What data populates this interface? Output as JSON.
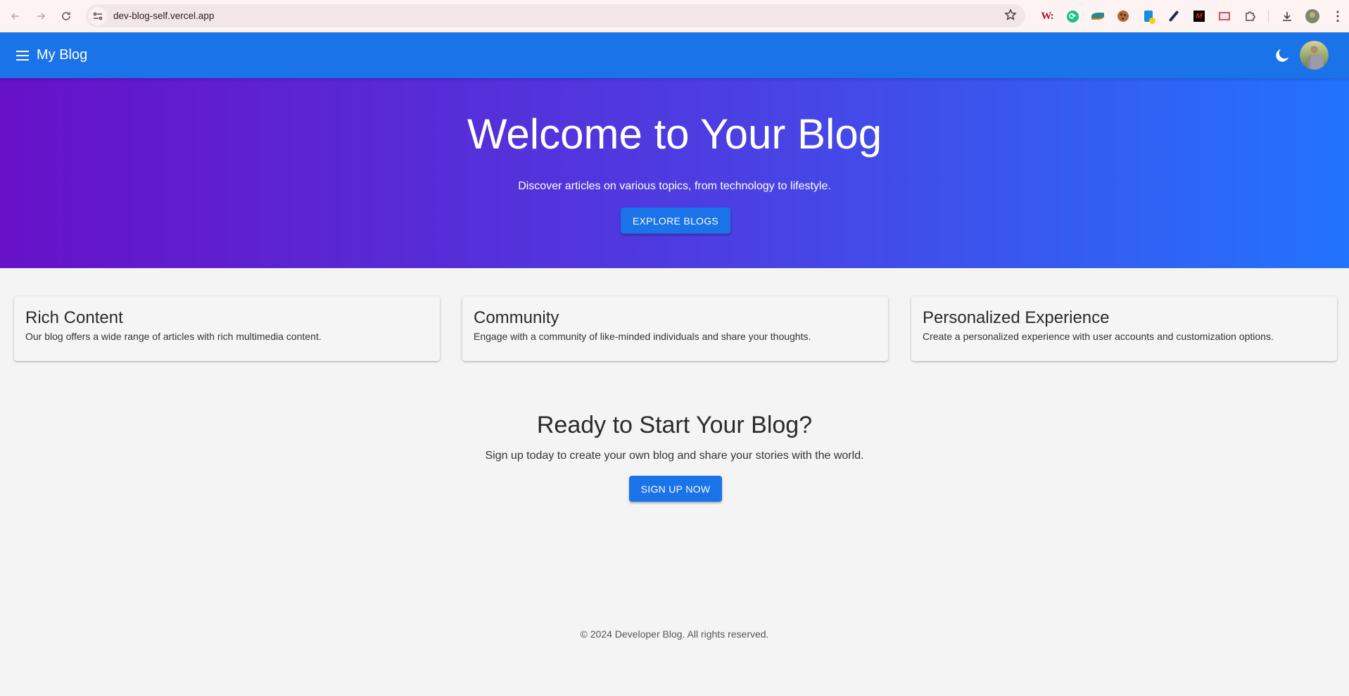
{
  "browser": {
    "url": "dev-blog-self.vercel.app",
    "extensions": [
      "wikiwand-extension",
      "sync-extension",
      "dolphins-extension",
      "cookie-extension",
      "doc-download-extension",
      "color-picker-extension",
      "m-extension",
      "ruler-extension"
    ]
  },
  "appbar": {
    "title": "My Blog",
    "menu_icon": "menu-icon",
    "theme_icon": "dark-mode-icon"
  },
  "hero": {
    "title": "Welcome to Your Blog",
    "subtitle": "Discover articles on various topics, from technology to lifestyle.",
    "button_label": "EXPLORE BLOGS",
    "gradient": [
      "#6711c9",
      "#2273fd"
    ]
  },
  "features": [
    {
      "title": "Rich Content",
      "description": "Our blog offers a wide range of articles with rich multimedia content."
    },
    {
      "title": "Community",
      "description": "Engage with a community of like-minded individuals and share your thoughts."
    },
    {
      "title": "Personalized Experience",
      "description": "Create a personalized experience with user accounts and customization options."
    }
  ],
  "cta": {
    "title": "Ready to Start Your Blog?",
    "subtitle": "Sign up today to create your own blog and share your stories with the world.",
    "button_label": "SIGN UP NOW"
  },
  "footer": {
    "text": "© 2024 Developer Blog. All rights reserved."
  },
  "colors": {
    "primary": "#1a73e8",
    "background": "#f4f4f4"
  }
}
